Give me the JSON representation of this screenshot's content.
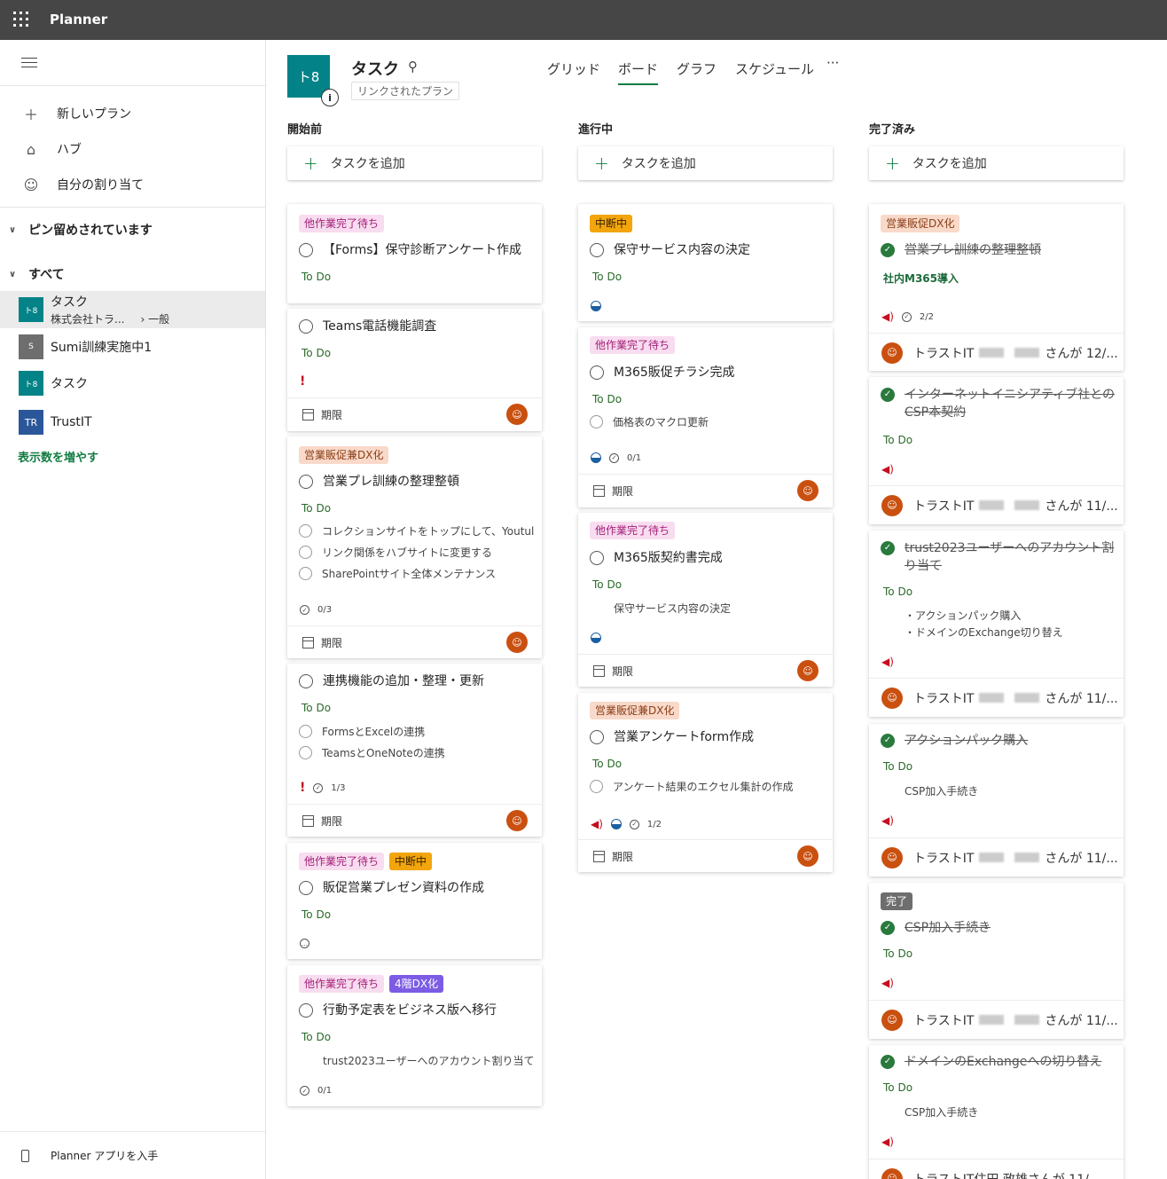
{
  "app": {
    "title": "Planner"
  },
  "sidebar": {
    "new_plan": "新しいプラン",
    "hub": "ハブ",
    "my_assignments": "自分の割り当て",
    "pinned": "ピン留めされています",
    "all": "すべて",
    "plans": [
      {
        "icon": "ト8",
        "name": "タスク",
        "sub1": "株式会社トラ...",
        "sub2": "一般",
        "color": "#038387"
      },
      {
        "icon": "S",
        "name": "Sumi訓練実施中1",
        "color": "#6e6e6e"
      },
      {
        "icon": "ト8",
        "name": "タスク",
        "color": "#038387"
      },
      {
        "icon": "TR",
        "name": "TrustIT",
        "color": "#2b579a"
      }
    ],
    "show_more": "表示数を増やす",
    "get_app": "Planner アプリを入手"
  },
  "plan": {
    "icon": "ト8",
    "title": "タスク",
    "linked": "リンクされたプラン",
    "info": "i"
  },
  "tabs": {
    "grid": "グリッド",
    "board": "ボード",
    "chart": "グラフ",
    "schedule": "スケジュール",
    "more": "···"
  },
  "add_task": "タスクを追加",
  "due": "期限",
  "columns": {
    "c1": "開始前",
    "c2": "進行中",
    "c3": "完了済み"
  },
  "c1": [
    {
      "labels": [
        "他作業完了待ち"
      ],
      "title": "【Forms】保守診断アンケート作成",
      "todo": "To Do"
    },
    {
      "title": "Teams電話機能調査",
      "todo": "To Do"
    },
    {
      "labels": [
        "営業販促兼DX化"
      ],
      "title": "営業プレ訓練の整理整頓",
      "todo": "To Do",
      "items": [
        "コレクションサイトをトップにして、Youtul",
        "リンク関係をハブサイトに変更する",
        "SharePointサイト全体メンテナンス"
      ],
      "count": "0/3"
    },
    {
      "title": "連携機能の追加・整理・更新",
      "todo": "To Do",
      "items": [
        "FormsとExcelの連携",
        "TeamsとOneNoteの連携"
      ],
      "count": "1/3"
    },
    {
      "labels": [
        "他作業完了待ち",
        "中断中"
      ],
      "title": "販促営業プレゼン資料の作成",
      "todo": "To Do"
    },
    {
      "labels": [
        "他作業完了待ち",
        "4階DX化"
      ],
      "title": "行動予定表をビジネス版へ移行",
      "todo": "To Do",
      "note": "trust2023ユーザーへのアカウント割り当て",
      "count": "0/1"
    }
  ],
  "c2": [
    {
      "labels": [
        "中断中"
      ],
      "title": "保守サービス内容の決定",
      "todo": "To Do"
    },
    {
      "labels": [
        "他作業完了待ち"
      ],
      "title": "M365販促チラシ完成",
      "todo": "To Do",
      "items": [
        "価格表のマクロ更新"
      ],
      "count": "0/1"
    },
    {
      "labels": [
        "他作業完了待ち"
      ],
      "title": "M365版契約書完成",
      "todo": "To Do",
      "note": "保守サービス内容の決定"
    },
    {
      "labels": [
        "営業販促兼DX化"
      ],
      "title": "営業アンケートform作成",
      "todo": "To Do",
      "items": [
        "アンケート結果のエクセル集計の作成"
      ],
      "count": "1/2"
    }
  ],
  "c3": [
    {
      "labels": [
        "営業販促DX化"
      ],
      "title": "営業プレ訓練の整理整頓",
      "bucket": "社内M365導入",
      "count": "2/2",
      "assignee": "トラストIT",
      "assigned": "さんが 12/..."
    },
    {
      "title": "インターネットイニシアティブ社とのCSP本契約",
      "todo": "To Do",
      "assignee": "トラストIT",
      "assigned": "さんが 11/..."
    },
    {
      "title": "trust2023ユーザーへのアカウント割り当て",
      "todo": "To Do",
      "notes": [
        "・アクションパック購入",
        "・ドメインのExchange切り替え"
      ],
      "assignee": "トラストIT",
      "assigned": "さんが 11/..."
    },
    {
      "title": "アクションパック購入",
      "todo": "To Do",
      "note": "CSP加入手続き",
      "assignee": "トラストIT",
      "assigned": "さんが 11/..."
    },
    {
      "labels": [
        "完了"
      ],
      "title": "CSP加入手続き",
      "todo": "To Do",
      "assignee": "トラストIT",
      "assigned": "さんが 11/..."
    },
    {
      "title": "ドメインのExchangeへの切り替え",
      "todo": "To Do",
      "note": "CSP加入手続き",
      "assignee": "トラストIT住田 政雄",
      "assigned": "さんが 11/..."
    }
  ],
  "colors": {
    "accent": "#107c41",
    "header": "#464646",
    "avatar": "#ca5010"
  }
}
